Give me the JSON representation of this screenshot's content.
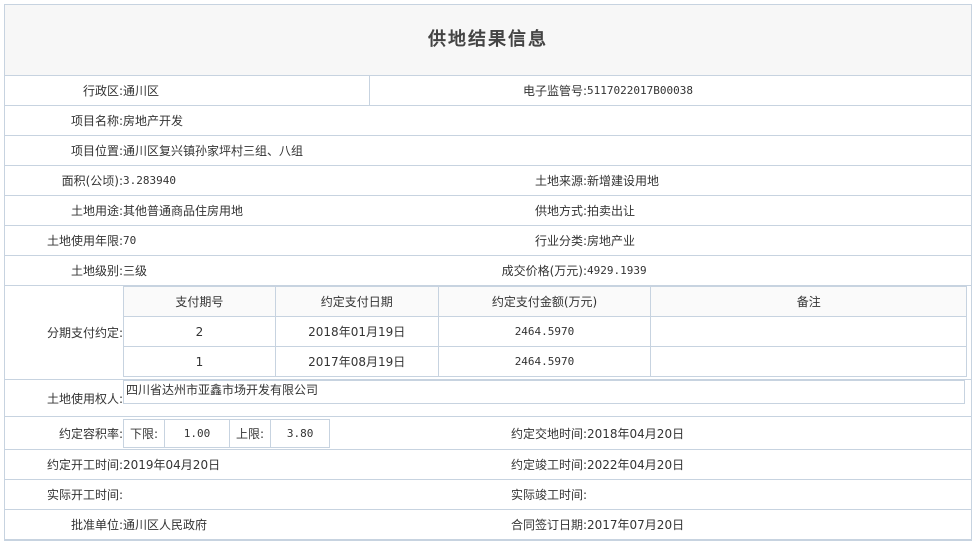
{
  "title": "供地结果信息",
  "district": {
    "label": "行政区:",
    "value": "通川区"
  },
  "supervision_no": {
    "label": "电子监管号:",
    "value": "5117022017B00038"
  },
  "project_name": {
    "label": "项目名称:",
    "value": "房地产开发"
  },
  "project_location": {
    "label": "项目位置:",
    "value": "通川区复兴镇孙家坪村三组、八组"
  },
  "area": {
    "label": "面积(公顷):",
    "value": "3.283940"
  },
  "land_source": {
    "label": "土地来源:",
    "value": "新增建设用地"
  },
  "land_use": {
    "label": "土地用途:",
    "value": "其他普通商品住房用地"
  },
  "supply_method": {
    "label": "供地方式:",
    "value": "拍卖出让"
  },
  "use_years": {
    "label": "土地使用年限:",
    "value": "70"
  },
  "industry": {
    "label": "行业分类:",
    "value": "房地产业"
  },
  "land_grade": {
    "label": "土地级别:",
    "value": "三级"
  },
  "deal_price": {
    "label": "成交价格(万元):",
    "value": "4929.1939"
  },
  "installments": {
    "label": "分期支付约定:",
    "headers": [
      "支付期号",
      "约定支付日期",
      "约定支付金额(万元)",
      "备注"
    ],
    "rows": [
      {
        "no": "2",
        "date": "2018年01月19日",
        "amount": "2464.5970",
        "note": ""
      },
      {
        "no": "1",
        "date": "2017年08月19日",
        "amount": "2464.5970",
        "note": ""
      }
    ]
  },
  "land_user": {
    "label": "土地使用权人:",
    "value": "四川省达州市亚鑫市场开发有限公司"
  },
  "far": {
    "label": "约定容积率:",
    "lower_label": "下限:",
    "lower": "1.00",
    "upper_label": "上限:",
    "upper": "3.80"
  },
  "handover_time": {
    "label": "约定交地时间:",
    "value": "2018年04月20日"
  },
  "start_time": {
    "label": "约定开工时间:",
    "value": "2019年04月20日"
  },
  "finish_time": {
    "label": "约定竣工时间:",
    "value": "2022年04月20日"
  },
  "actual_start": {
    "label": "实际开工时间:",
    "value": ""
  },
  "actual_finish": {
    "label": "实际竣工时间:",
    "value": ""
  },
  "approval_unit": {
    "label": "批准单位:",
    "value": "通川区人民政府"
  },
  "contract_date": {
    "label": "合同签订日期:",
    "value": "2017年07月20日"
  }
}
